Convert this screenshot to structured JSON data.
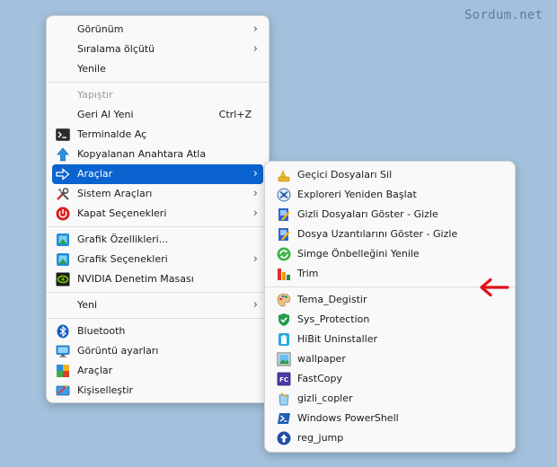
{
  "watermark": "Sordum.net",
  "main_menu": {
    "view": "Görünüm",
    "sort_by": "Sıralama ölçütü",
    "refresh": "Yenile",
    "paste": "Yapıştır",
    "undo_new": "Geri Al Yeni",
    "undo_shortcut": "Ctrl+Z",
    "open_terminal": "Terminalde Aç",
    "copy_to_anahtara": "Kopyalanan Anahtara Atla",
    "tools": "Araçlar",
    "system_tools": "Sistem Araçları",
    "shutdown_options": "Kapat Seçenekleri",
    "graphics_properties": "Grafik Özellikleri...",
    "graphics_options": "Grafik Seçenekleri",
    "nvidia_panel": "NVIDIA Denetim Masası",
    "new": "Yeni",
    "bluetooth": "Bluetooth",
    "display_settings": "Görüntü ayarları",
    "tools2": "Araçlar",
    "personalize": "Kişiselleştir"
  },
  "sub_menu": {
    "items": [
      "Geçici Dosyaları Sil",
      "Exploreri Yeniden Başlat",
      "Gizli Dosyaları Göster - Gizle",
      "Dosya Uzantılarını Göster - Gizle",
      "Simge Önbelleğini Yenile",
      "Trim",
      "Tema_Degistir",
      "Sys_Protection",
      "HiBit Uninstaller",
      "wallpaper",
      "FastCopy",
      "gizli_copler",
      "Windows PowerShell",
      "reg_jump"
    ]
  },
  "colors": {
    "highlight": "#0a63cf",
    "annotation_arrow": "#e0101a"
  }
}
